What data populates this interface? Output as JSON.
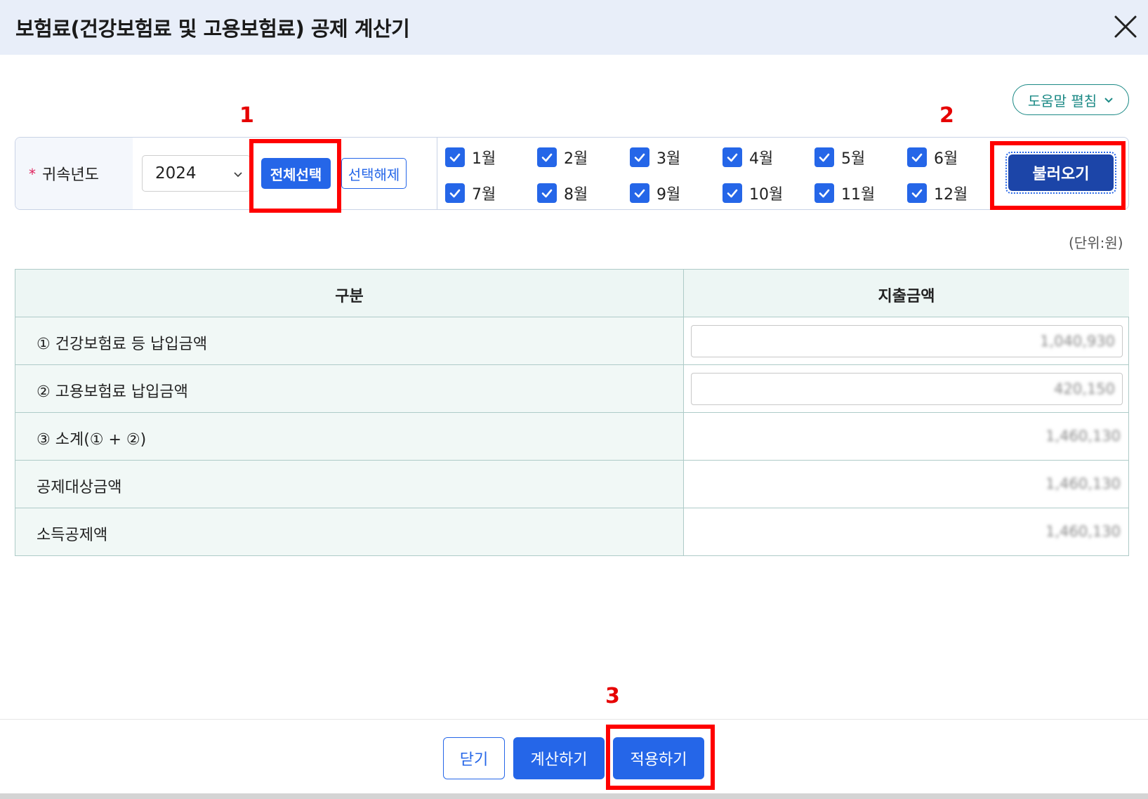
{
  "dialog": {
    "title": "보험료(건강보험료 및 고용보험료) 공제 계산기",
    "help_toggle_label": "도움말 펼침"
  },
  "annotations": [
    "1",
    "2",
    "3"
  ],
  "filter": {
    "required_mark": "*",
    "label": "귀속년도",
    "year": "2024",
    "select_all_label": "전체선택",
    "deselect_label": "선택해제",
    "months": [
      {
        "label": "1월",
        "checked": true
      },
      {
        "label": "2월",
        "checked": true
      },
      {
        "label": "3월",
        "checked": true
      },
      {
        "label": "4월",
        "checked": true
      },
      {
        "label": "5월",
        "checked": true
      },
      {
        "label": "6월",
        "checked": true
      },
      {
        "label": "7월",
        "checked": true
      },
      {
        "label": "8월",
        "checked": true
      },
      {
        "label": "9월",
        "checked": true
      },
      {
        "label": "10월",
        "checked": true
      },
      {
        "label": "11월",
        "checked": true
      },
      {
        "label": "12월",
        "checked": true
      }
    ],
    "load_label": "불러오기"
  },
  "unit_text": "(단위:원)",
  "table": {
    "headers": [
      "구분",
      "지출금액"
    ],
    "rows": [
      {
        "label": "① 건강보험료 등 납입금액",
        "amount": "1,040,930",
        "editable": true
      },
      {
        "label": "② 고용보험료 납입금액",
        "amount": "420,150",
        "editable": true
      },
      {
        "label": "③ 소계(① + ②)",
        "amount": "1,460,130",
        "editable": false
      },
      {
        "label": "공제대상금액",
        "amount": "1,460,130",
        "editable": false
      },
      {
        "label": "소득공제액",
        "amount": "1,460,130",
        "editable": false
      }
    ]
  },
  "footer": {
    "close_label": "닫기",
    "calculate_label": "계산하기",
    "apply_label": "적용하기"
  },
  "colors": {
    "primary": "#2566e8",
    "primary_dark": "#1c45a8",
    "title_bar_bg": "#e8eef9",
    "table_header_bg": "#edf6f4",
    "help_accent": "#1c8a86",
    "annotation_red": "#ff0000"
  }
}
